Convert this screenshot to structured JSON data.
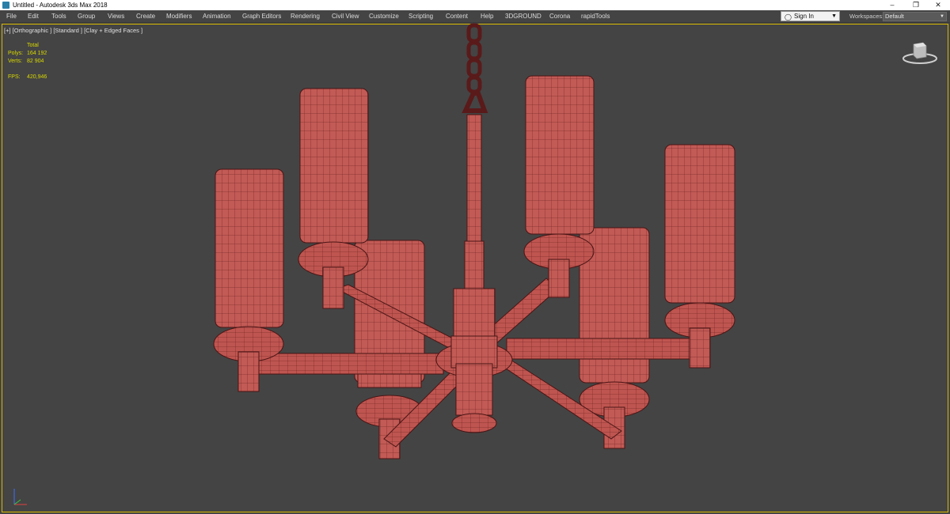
{
  "window": {
    "title": "Untitled - Autodesk 3ds Max 2018",
    "controls": {
      "minimize": "–",
      "maximize": "❐",
      "close": "✕"
    }
  },
  "menu": {
    "items": [
      "File",
      "Edit",
      "Tools",
      "Group",
      "Views",
      "Create",
      "Modifiers",
      "Animation",
      "Graph Editors",
      "Rendering",
      "Civil View",
      "Customize",
      "Scripting",
      "Content",
      "Help",
      "3DGROUND",
      "Corona",
      "rapidTools"
    ]
  },
  "account": {
    "sign_in_label": "Sign In"
  },
  "workspaces": {
    "label": "Workspaces:",
    "value": "Default"
  },
  "viewport": {
    "label": "[+] [Orthographic ] [Standard ] [Clay + Edged Faces ]",
    "stats": {
      "total_label": "Total",
      "polys_label": "Polys:",
      "polys_value": "164 192",
      "verts_label": "Verts:",
      "verts_value": "82 904",
      "fps_label": "FPS:",
      "fps_value": "420,946"
    }
  },
  "colors": {
    "accent": "#d8b800",
    "model_fill": "#c25a55",
    "model_wire": "#5a1a1a",
    "background": "#444444"
  }
}
